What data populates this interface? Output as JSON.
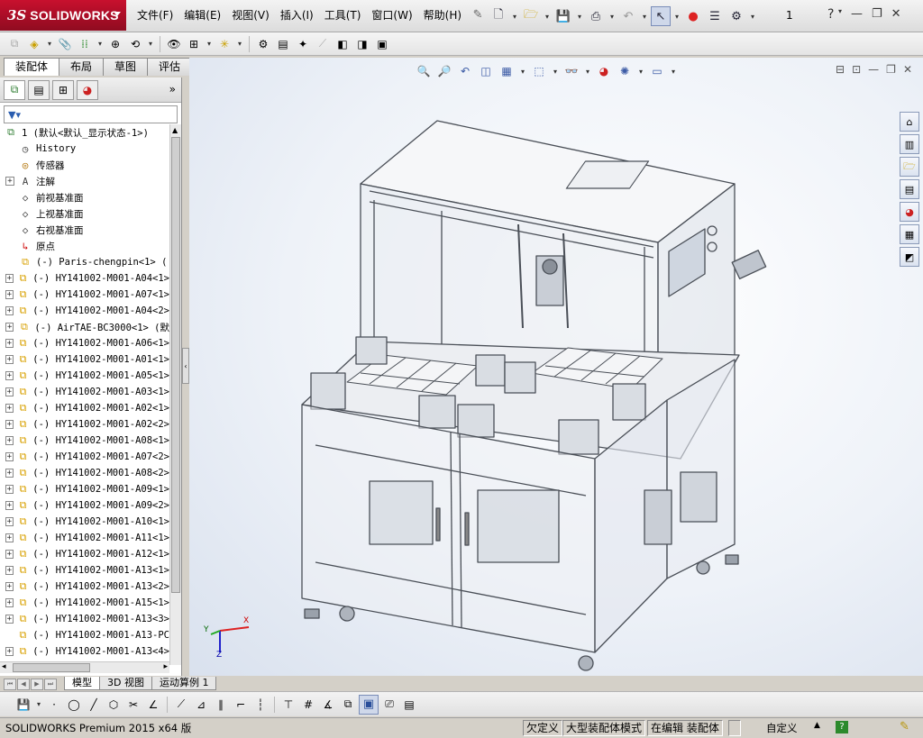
{
  "app": {
    "logo_ds": "3S",
    "logo_text": "SOLIDWORKS"
  },
  "menu": [
    "文件(F)",
    "编辑(E)",
    "视图(V)",
    "插入(I)",
    "工具(T)",
    "窗口(W)",
    "帮助(H)"
  ],
  "page_number": "1",
  "command_tabs": [
    "装配体",
    "布局",
    "草图",
    "评估"
  ],
  "active_command_tab": "装配体",
  "panel": {
    "more": "»"
  },
  "tree": {
    "root": "1  (默认<默认_显示状态-1>)",
    "items": [
      {
        "label": "History",
        "expand": false,
        "icon": "history-icon"
      },
      {
        "label": "传感器",
        "expand": false,
        "icon": "sensor-icon"
      },
      {
        "label": "注解",
        "expand": true,
        "icon": "annotation-icon"
      },
      {
        "label": "前视基准面",
        "expand": false,
        "icon": "plane-icon"
      },
      {
        "label": "上视基准面",
        "expand": false,
        "icon": "plane-icon"
      },
      {
        "label": "右视基准面",
        "expand": false,
        "icon": "plane-icon"
      },
      {
        "label": "原点",
        "expand": false,
        "icon": "origin-icon"
      },
      {
        "label": "(-) Paris-chengpin<1> (",
        "expand": false,
        "icon": "part-icon"
      },
      {
        "label": "(-) HY141002-M001-A04<1>",
        "expand": true,
        "icon": "part-icon"
      },
      {
        "label": "(-) HY141002-M001-A07<1>",
        "expand": true,
        "icon": "part-icon"
      },
      {
        "label": "(-) HY141002-M001-A04<2>",
        "expand": true,
        "icon": "part-icon"
      },
      {
        "label": "(-) AirTAE-BC3000<1> (默",
        "expand": true,
        "icon": "part-icon"
      },
      {
        "label": "(-) HY141002-M001-A06<1>",
        "expand": true,
        "icon": "part-icon"
      },
      {
        "label": "(-) HY141002-M001-A01<1>",
        "expand": true,
        "icon": "part-icon"
      },
      {
        "label": "(-) HY141002-M001-A05<1>",
        "expand": true,
        "icon": "part-icon"
      },
      {
        "label": "(-) HY141002-M001-A03<1>",
        "expand": true,
        "icon": "part-icon"
      },
      {
        "label": "(-) HY141002-M001-A02<1>",
        "expand": true,
        "icon": "part-icon"
      },
      {
        "label": "(-) HY141002-M001-A02<2>",
        "expand": true,
        "icon": "part-icon"
      },
      {
        "label": "(-) HY141002-M001-A08<1>",
        "expand": true,
        "icon": "part-icon"
      },
      {
        "label": "(-) HY141002-M001-A07<2>",
        "expand": true,
        "icon": "part-icon"
      },
      {
        "label": "(-) HY141002-M001-A08<2>",
        "expand": true,
        "icon": "part-icon"
      },
      {
        "label": "(-) HY141002-M001-A09<1>",
        "expand": true,
        "icon": "part-icon"
      },
      {
        "label": "(-) HY141002-M001-A09<2>",
        "expand": true,
        "icon": "part-icon"
      },
      {
        "label": "(-) HY141002-M001-A10<1>",
        "expand": true,
        "icon": "part-icon"
      },
      {
        "label": "(-) HY141002-M001-A11<1>",
        "expand": true,
        "icon": "part-icon"
      },
      {
        "label": "(-) HY141002-M001-A12<1>",
        "expand": true,
        "icon": "part-icon"
      },
      {
        "label": "(-) HY141002-M001-A13<1>",
        "expand": true,
        "icon": "part-icon"
      },
      {
        "label": "(-) HY141002-M001-A13<2>",
        "expand": true,
        "icon": "part-icon"
      },
      {
        "label": "(-) HY141002-M001-A15<1>",
        "expand": true,
        "icon": "part-icon"
      },
      {
        "label": "(-) HY141002-M001-A13<3>",
        "expand": true,
        "icon": "part-icon"
      },
      {
        "label": "(-) HY141002-M001-A13-PC",
        "expand": false,
        "icon": "part-icon"
      },
      {
        "label": "(-) HY141002-M001-A13<4>",
        "expand": true,
        "icon": "part-icon"
      }
    ]
  },
  "bottom_tabs": [
    "模型",
    "3D 视图",
    "运动算例 1"
  ],
  "active_bottom_tab": "模型",
  "status": {
    "product": "SOLIDWORKS Premium 2015 x64 版",
    "cells": [
      "欠定义",
      "大型装配体模式",
      "在编辑 装配体"
    ],
    "units": "自定义",
    "help": "?"
  },
  "triad": {
    "x": "X",
    "y": "Y",
    "z": "Z"
  },
  "colors": {
    "brand": "#c8102e",
    "viewport_bg": "#eef2f8",
    "part_icon": "#d8a000"
  }
}
